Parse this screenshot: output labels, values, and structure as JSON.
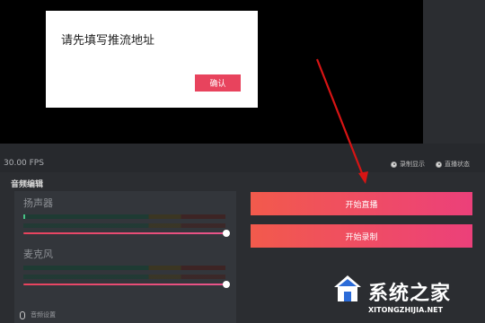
{
  "dialog": {
    "message": "请先填写推流地址",
    "confirm_label": "确认"
  },
  "status": {
    "fps": "30.00 FPS",
    "option_record_display": "录制显示",
    "option_live_status": "直播状态"
  },
  "audio": {
    "section_title": "音频编辑",
    "speaker_label": "扬声器",
    "mic_label": "麦克风",
    "speaker_volume": 1.0,
    "mic_volume": 1.0,
    "settings_label": "音频设置"
  },
  "actions": {
    "start_live_label": "开始直播",
    "start_record_label": "开始录制"
  },
  "watermark": {
    "title": "系统之家",
    "url": "XITONGZHIJIA.NET"
  },
  "colors": {
    "accent": "#e8435d",
    "arrow": "#d81414",
    "preview_bg": "#000000",
    "panel_bg": "#2b2d31"
  }
}
